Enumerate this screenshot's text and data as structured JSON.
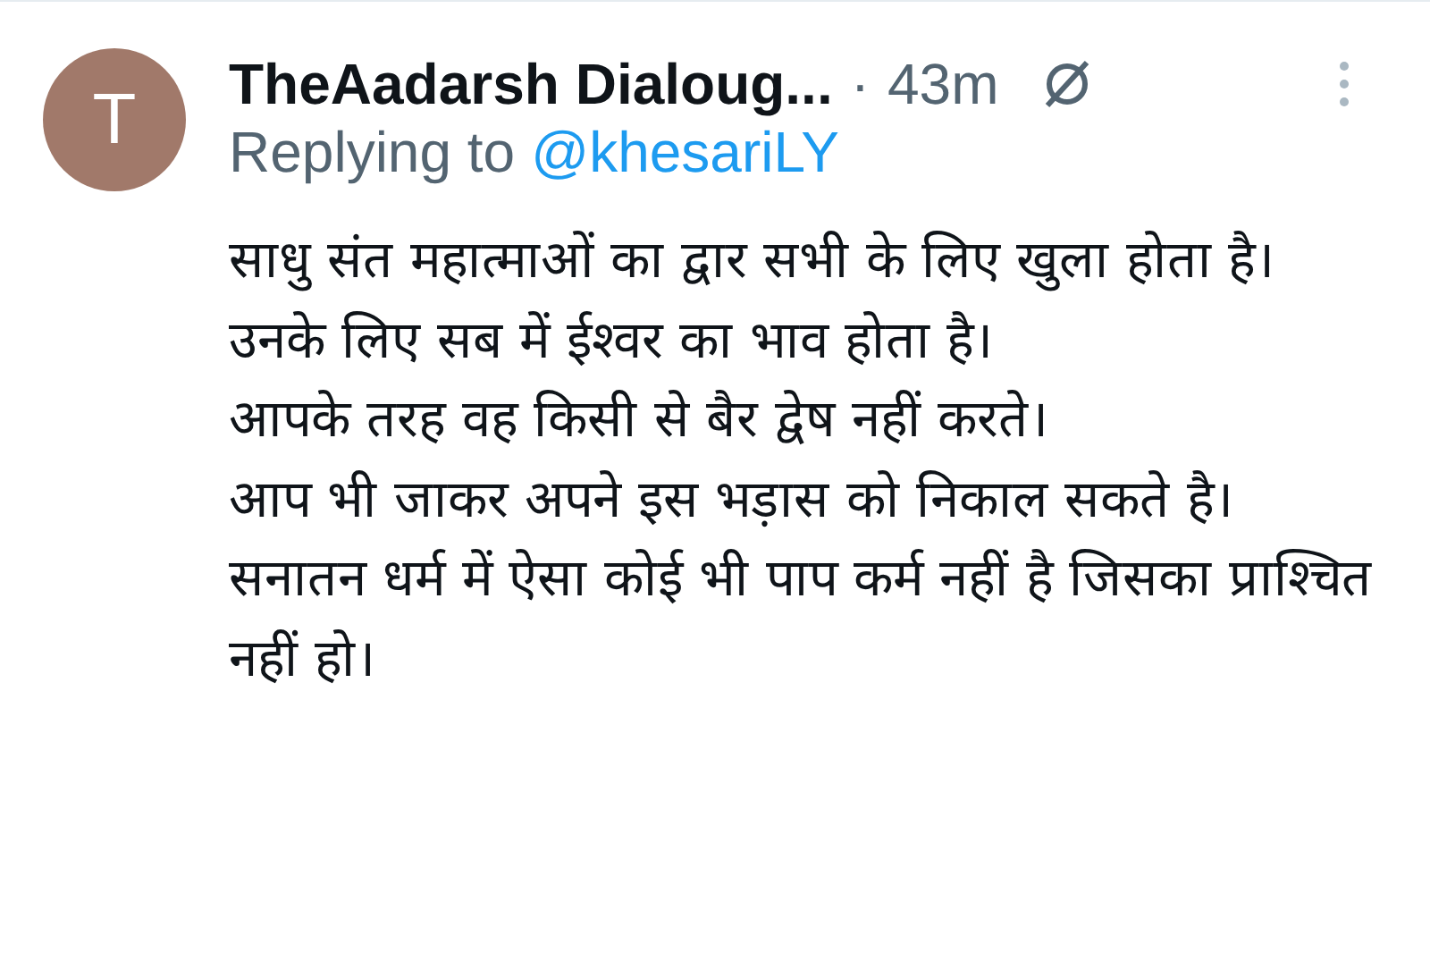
{
  "tweet": {
    "avatar_letter": "T",
    "author": "TheAadarsh Dialoug...",
    "separator": "·",
    "time": "43m",
    "reply_prefix": "Replying to",
    "reply_handle": "@khesariLY",
    "paragraphs": [
      "साधु संत महात्माओं का द्वार सभी के लिए खुला होता है।",
      "उनके लिए सब में ईश्वर का भाव होता है।",
      "आपके तरह वह किसी से बैर द्वेष नहीं करते।",
      "आप भी जाकर अपने इस भड़ास को निकाल सकते है।",
      "सनातन धर्म में ऐसा कोई भी पाप कर्म नहीं है जिसका प्राश्चित नहीं हो।"
    ]
  }
}
